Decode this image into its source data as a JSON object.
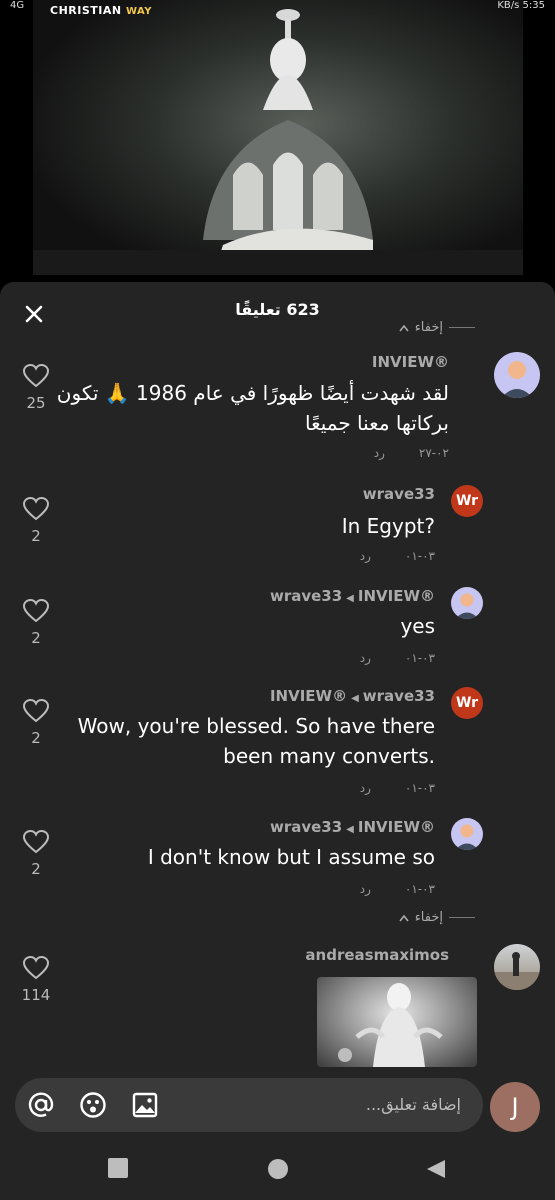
{
  "status_bar": {
    "left_text": "4G",
    "right_text": "KB/s 5:35"
  },
  "video": {
    "logo_text": "CHRISTIAN",
    "logo_accent": "WAY"
  },
  "sheet": {
    "title": "623 تعليقًا",
    "hide_label": "إخفاء"
  },
  "comments": [
    {
      "username": "INVIEW®",
      "text": "لقد شهدت أيضًا ظهورًا في عام 1986 🙏 تكون بركاتها معنا جميعًا",
      "date": "٠٢-٢٧",
      "reply_label": "رد",
      "likes": "25"
    },
    {
      "username": "wrave33",
      "avatar_text": "Wr",
      "text": "In Egypt?",
      "date": "٠٣-٠١",
      "reply_label": "رد",
      "likes": "2"
    },
    {
      "username": "wrave33",
      "reply_to": "INVIEW®",
      "text": "yes",
      "date": "٠٣-٠١",
      "reply_label": "رد",
      "likes": "2"
    },
    {
      "username": "INVIEW®",
      "reply_to": "wrave33",
      "avatar_text": "Wr",
      "text": "Wow, you're blessed. So have there been many converts.",
      "date": "٠٣-٠١",
      "reply_label": "رد",
      "likes": "2"
    },
    {
      "username": "wrave33",
      "reply_to": "INVIEW®",
      "text": "I don't know but I assume so",
      "date": "٠٣-٠١",
      "reply_label": "رد",
      "likes": "2"
    },
    {
      "username": "andreasmaximos",
      "likes": "114"
    }
  ],
  "input": {
    "placeholder": "إضافة تعليق...",
    "user_initial": "J"
  },
  "colors": {
    "sheet_bg": "#242424",
    "input_bg": "#3a3a3a",
    "wr_avatar": "#c0371a",
    "user_avatar": "#9d6f62"
  }
}
